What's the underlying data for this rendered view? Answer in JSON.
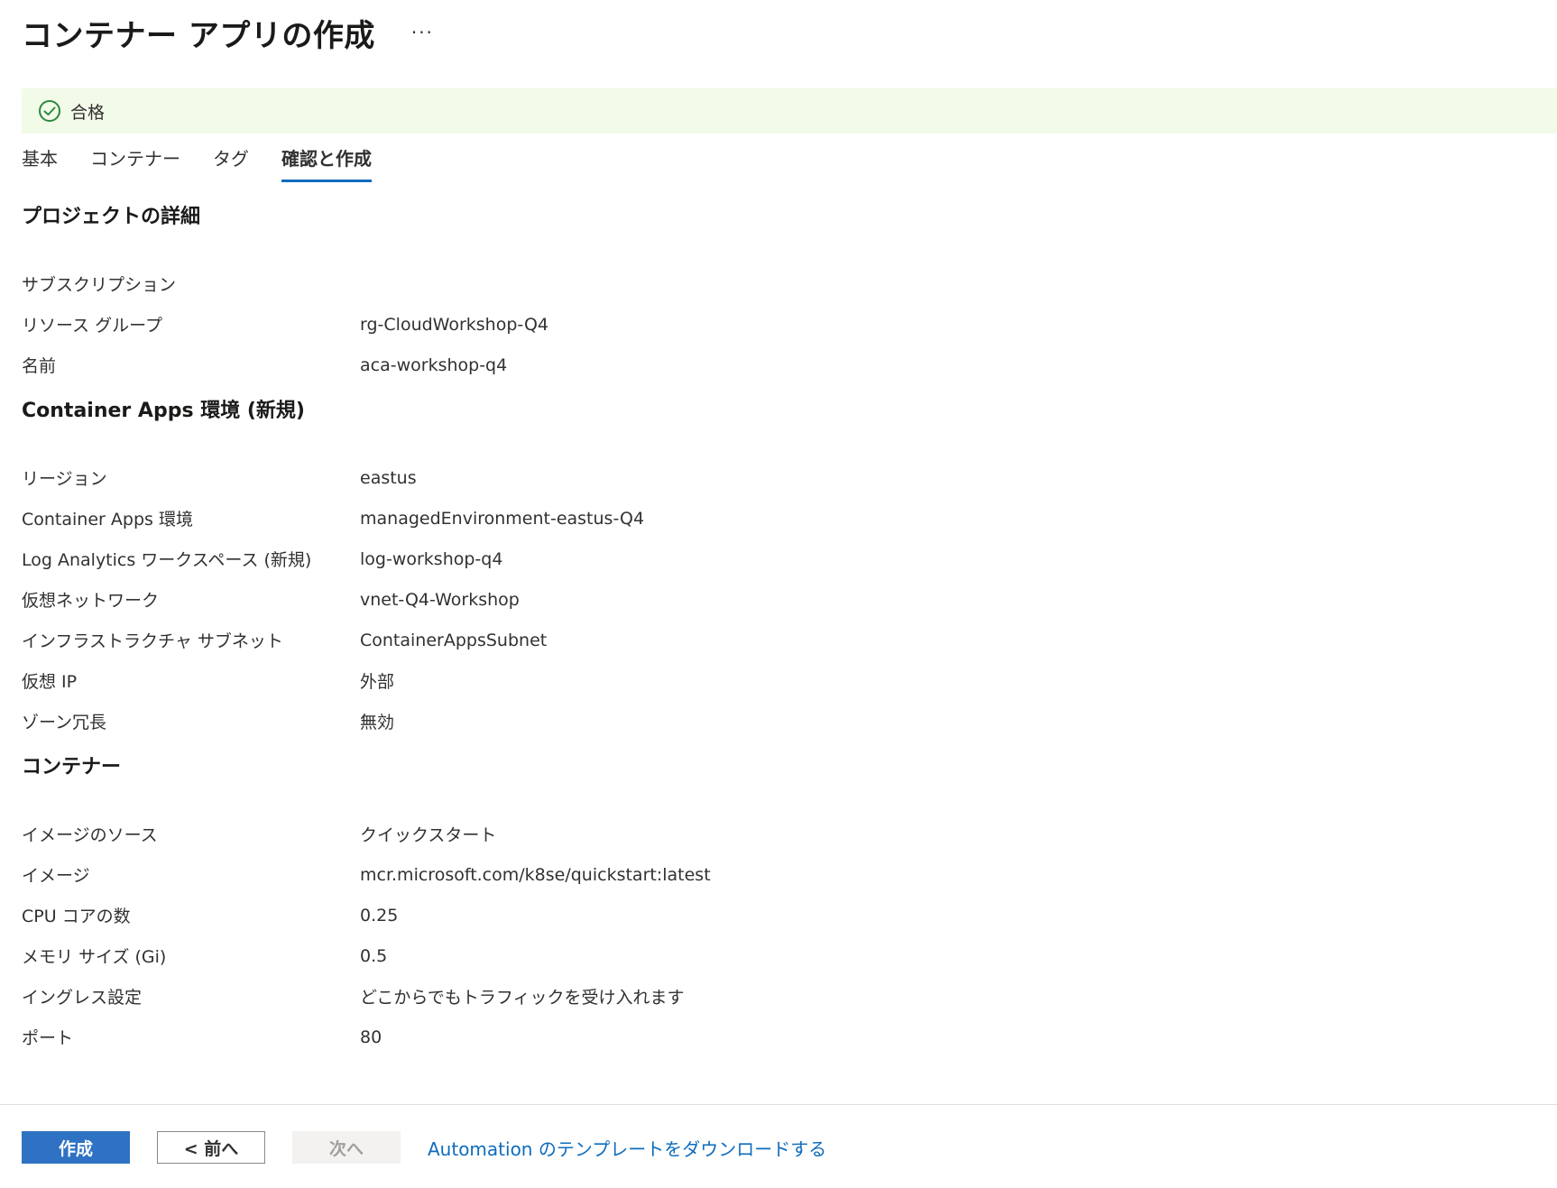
{
  "header": {
    "title": "コンテナー アプリの作成",
    "more_label": "···"
  },
  "banner": {
    "icon": "check-circle-icon",
    "text": "合格",
    "color": "#2b8a3e"
  },
  "tabs": [
    {
      "label": "基本",
      "active": false
    },
    {
      "label": "コンテナー",
      "active": false
    },
    {
      "label": "タグ",
      "active": false
    },
    {
      "label": "確認と作成",
      "active": true
    }
  ],
  "sections": [
    {
      "title": "プロジェクトの詳細",
      "rows": [
        {
          "label": "サブスクリプション",
          "value": ""
        },
        {
          "label": "リソース グループ",
          "value": "rg-CloudWorkshop-Q4"
        },
        {
          "label": "名前",
          "value": "aca-workshop-q4"
        }
      ]
    },
    {
      "title": "Container Apps 環境 (新規)",
      "rows": [
        {
          "label": "リージョン",
          "value": "eastus"
        },
        {
          "label": "Container Apps 環境",
          "value": "managedEnvironment-eastus-Q4"
        },
        {
          "label": "Log Analytics ワークスペース (新規)",
          "value": "log-workshop-q4"
        },
        {
          "label": "仮想ネットワーク",
          "value": "vnet-Q4-Workshop"
        },
        {
          "label": "インフラストラクチャ サブネット",
          "value": "ContainerAppsSubnet"
        },
        {
          "label": "仮想 IP",
          "value": "外部"
        },
        {
          "label": "ゾーン冗長",
          "value": "無効"
        }
      ]
    },
    {
      "title": "コンテナー",
      "rows": [
        {
          "label": "イメージのソース",
          "value": "クイックスタート"
        },
        {
          "label": "イメージ",
          "value": "mcr.microsoft.com/k8se/quickstart:latest"
        },
        {
          "label": "CPU コアの数",
          "value": "0.25"
        },
        {
          "label": "メモリ サイズ (Gi)",
          "value": "0.5"
        },
        {
          "label": "イングレス設定",
          "value": "どこからでもトラフィックを受け入れます"
        },
        {
          "label": "ポート",
          "value": "80"
        }
      ]
    }
  ],
  "footer": {
    "create_label": "作成",
    "prev_label": "< 前へ",
    "next_label": "次へ",
    "download_link": "Automation のテンプレートをダウンロードする"
  },
  "colors": {
    "accent": "#0f6cbd",
    "primary_button": "#2f72c3",
    "banner_bg": "#f2fae8"
  }
}
